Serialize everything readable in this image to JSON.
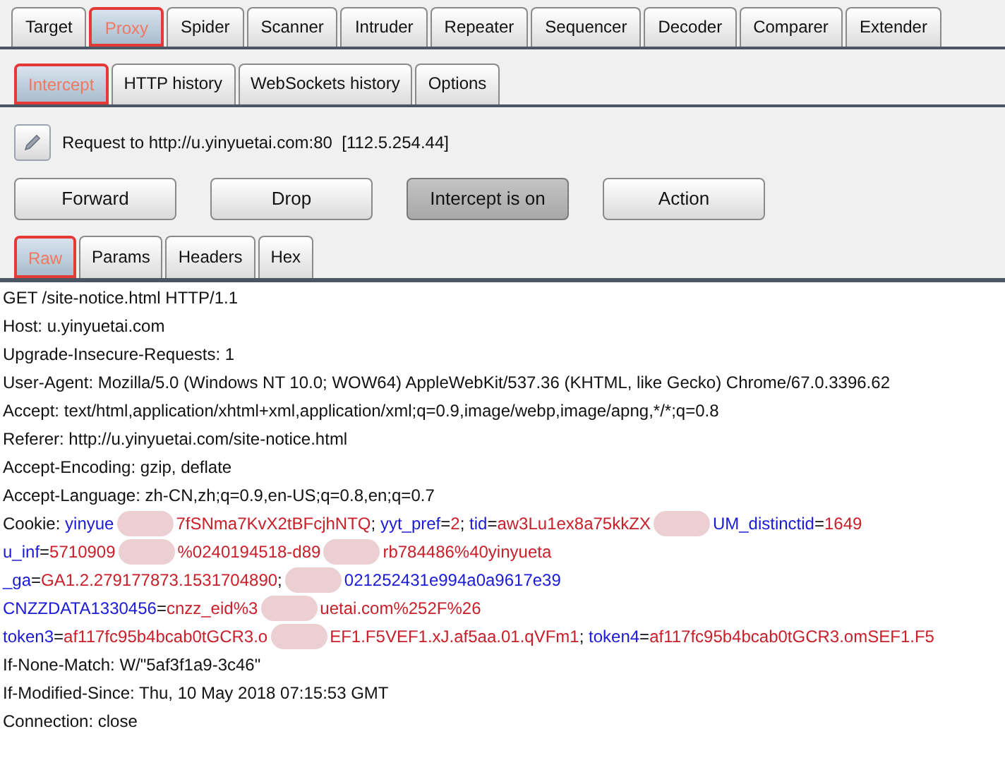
{
  "main_tabs": [
    {
      "label": "Target",
      "selected": false
    },
    {
      "label": "Proxy",
      "selected": true
    },
    {
      "label": "Spider",
      "selected": false
    },
    {
      "label": "Scanner",
      "selected": false
    },
    {
      "label": "Intruder",
      "selected": false
    },
    {
      "label": "Repeater",
      "selected": false
    },
    {
      "label": "Sequencer",
      "selected": false
    },
    {
      "label": "Decoder",
      "selected": false
    },
    {
      "label": "Comparer",
      "selected": false
    },
    {
      "label": "Extender",
      "selected": false
    }
  ],
  "proxy_tabs": [
    {
      "label": "Intercept",
      "selected": true
    },
    {
      "label": "HTTP history",
      "selected": false
    },
    {
      "label": "WebSockets history",
      "selected": false
    },
    {
      "label": "Options",
      "selected": false
    }
  ],
  "request_info": "Request to http://u.yinyuetai.com:80  [112.5.254.44]",
  "buttons": [
    {
      "label": "Forward",
      "pressed": false
    },
    {
      "label": "Drop",
      "pressed": false
    },
    {
      "label": "Intercept is on",
      "pressed": true
    },
    {
      "label": "Action",
      "pressed": false
    }
  ],
  "message_tabs": [
    {
      "label": "Raw",
      "selected": true
    },
    {
      "label": "Params",
      "selected": false
    },
    {
      "label": "Headers",
      "selected": false
    },
    {
      "label": "Hex",
      "selected": false
    }
  ],
  "request_lines": [
    [
      {
        "kind": "plain",
        "text": "GET /site-notice.html HTTP/1.1"
      }
    ],
    [
      {
        "kind": "plain",
        "text": "Host: u.yinyuetai.com"
      }
    ],
    [
      {
        "kind": "plain",
        "text": "Upgrade-Insecure-Requests: 1"
      }
    ],
    [
      {
        "kind": "plain",
        "text": "User-Agent: Mozilla/5.0 (Windows NT 10.0; WOW64) AppleWebKit/537.36 (KHTML, like Gecko) Chrome/67.0.3396.62"
      }
    ],
    [
      {
        "kind": "plain",
        "text": "Accept: text/html,application/xhtml+xml,application/xml;q=0.9,image/webp,image/apng,*/*;q=0.8"
      }
    ],
    [
      {
        "kind": "plain",
        "text": "Referer: http://u.yinyuetai.com/site-notice.html"
      }
    ],
    [
      {
        "kind": "plain",
        "text": "Accept-Encoding: gzip, deflate"
      }
    ],
    [
      {
        "kind": "plain",
        "text": "Accept-Language: zh-CN,zh;q=0.9,en-US;q=0.8,en;q=0.7"
      }
    ],
    [
      {
        "kind": "plain",
        "text": "Cookie: "
      },
      {
        "kind": "name",
        "text": "yinyue"
      },
      {
        "kind": "redacted"
      },
      {
        "kind": "value",
        "text": "7fSNma7KvX2tBFcjhNTQ"
      },
      {
        "kind": "plain",
        "text": "; "
      },
      {
        "kind": "name",
        "text": "yyt_pref"
      },
      {
        "kind": "plain",
        "text": "="
      },
      {
        "kind": "value",
        "text": "2"
      },
      {
        "kind": "plain",
        "text": "; "
      },
      {
        "kind": "name",
        "text": "tid"
      },
      {
        "kind": "plain",
        "text": "="
      },
      {
        "kind": "value",
        "text": "aw3Lu1ex8a75kkZX"
      },
      {
        "kind": "redacted"
      },
      {
        "kind": "name",
        "text": "UM_distinctid"
      },
      {
        "kind": "plain",
        "text": "="
      },
      {
        "kind": "value",
        "text": "1649"
      }
    ],
    [
      {
        "kind": "name",
        "text": "u_inf"
      },
      {
        "kind": "plain",
        "text": "="
      },
      {
        "kind": "value",
        "text": "5710909"
      },
      {
        "kind": "redacted"
      },
      {
        "kind": "value",
        "text": "%0240194518-d89"
      },
      {
        "kind": "redacted"
      },
      {
        "kind": "value",
        "text": "rb784486%40yinyueta"
      }
    ],
    [
      {
        "kind": "name",
        "text": "_ga"
      },
      {
        "kind": "plain",
        "text": "="
      },
      {
        "kind": "value",
        "text": "GA1.2.279177873.1531704890"
      },
      {
        "kind": "plain",
        "text": ";"
      },
      {
        "kind": "redacted"
      },
      {
        "kind": "name",
        "text": "021252431e994a0a9617e39"
      }
    ],
    [
      {
        "kind": "name",
        "text": "CNZZDATA1330456"
      },
      {
        "kind": "plain",
        "text": "="
      },
      {
        "kind": "value",
        "text": "cnzz_eid%3"
      },
      {
        "kind": "redacted"
      },
      {
        "kind": "value",
        "text": "uetai.com%252F%26"
      }
    ],
    [
      {
        "kind": "name",
        "text": "token3"
      },
      {
        "kind": "plain",
        "text": "="
      },
      {
        "kind": "value",
        "text": "af117fc95b4bcab0tGCR3.o"
      },
      {
        "kind": "redacted"
      },
      {
        "kind": "value",
        "text": "EF1.F5VEF1.xJ.af5aa.01.qVFm1"
      },
      {
        "kind": "plain",
        "text": "; "
      },
      {
        "kind": "name",
        "text": "token4"
      },
      {
        "kind": "plain",
        "text": "="
      },
      {
        "kind": "value",
        "text": "af117fc95b4bcab0tGCR3.omSEF1.F5"
      }
    ],
    [
      {
        "kind": "plain",
        "text": "If-None-Match: W/\"5af3f1a9-3c46\""
      }
    ],
    [
      {
        "kind": "plain",
        "text": "If-Modified-Since: Thu, 10 May 2018 07:15:53 GMT"
      }
    ],
    [
      {
        "kind": "plain",
        "text": "Connection: close"
      }
    ]
  ]
}
